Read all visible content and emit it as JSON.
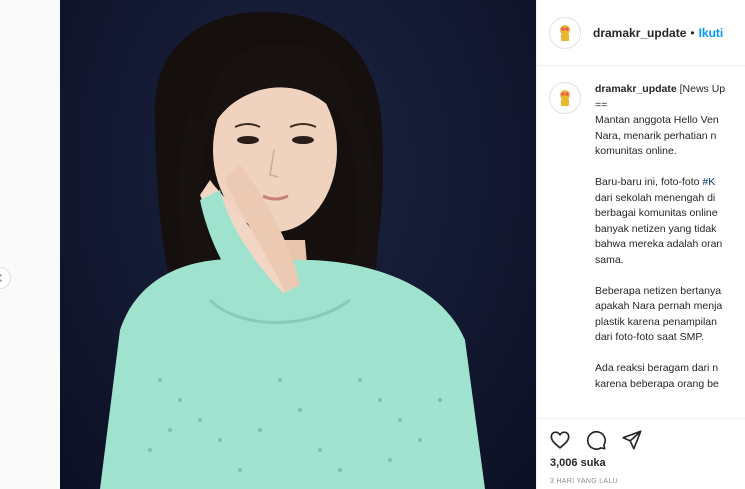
{
  "post": {
    "username": "dramakr_update",
    "follow_label": "Ikuti",
    "separator": "•",
    "caption": {
      "username": "dramakr_update",
      "first_line": "[News Up",
      "line_2": "==",
      "para1": [
        "Mantan anggota Hello Ven",
        "Nara, menarik perhatian n",
        "komunitas online."
      ],
      "para2_prefix": "Baru-baru ini, foto-foto ",
      "para2_hashtag": "#K",
      "para2_rest": [
        "dari sekolah menengah di",
        "berbagai komunitas online",
        "banyak netizen yang tidak",
        "bahwa mereka adalah oran",
        "sama."
      ],
      "para3": [
        "Beberapa netizen bertanya",
        "apakah Nara pernah menja",
        "plastik karena penampilan",
        "dari foto-foto saat SMP."
      ],
      "para4": [
        "Ada reaksi beragam dari n",
        "karena beberapa orang be"
      ]
    },
    "likes": "3,006 suka",
    "timestamp": "3 HARI YANG LALU"
  },
  "icons": {
    "like": "heart-icon",
    "comment": "comment-icon",
    "share": "share-icon",
    "prev": "chevron-left-icon",
    "next": "chevron-right-icon"
  },
  "colors": {
    "accent": "#0095f6",
    "hashtag": "#00376b",
    "photo_bg": "#141a33",
    "top_color": "#9fe3cf"
  }
}
